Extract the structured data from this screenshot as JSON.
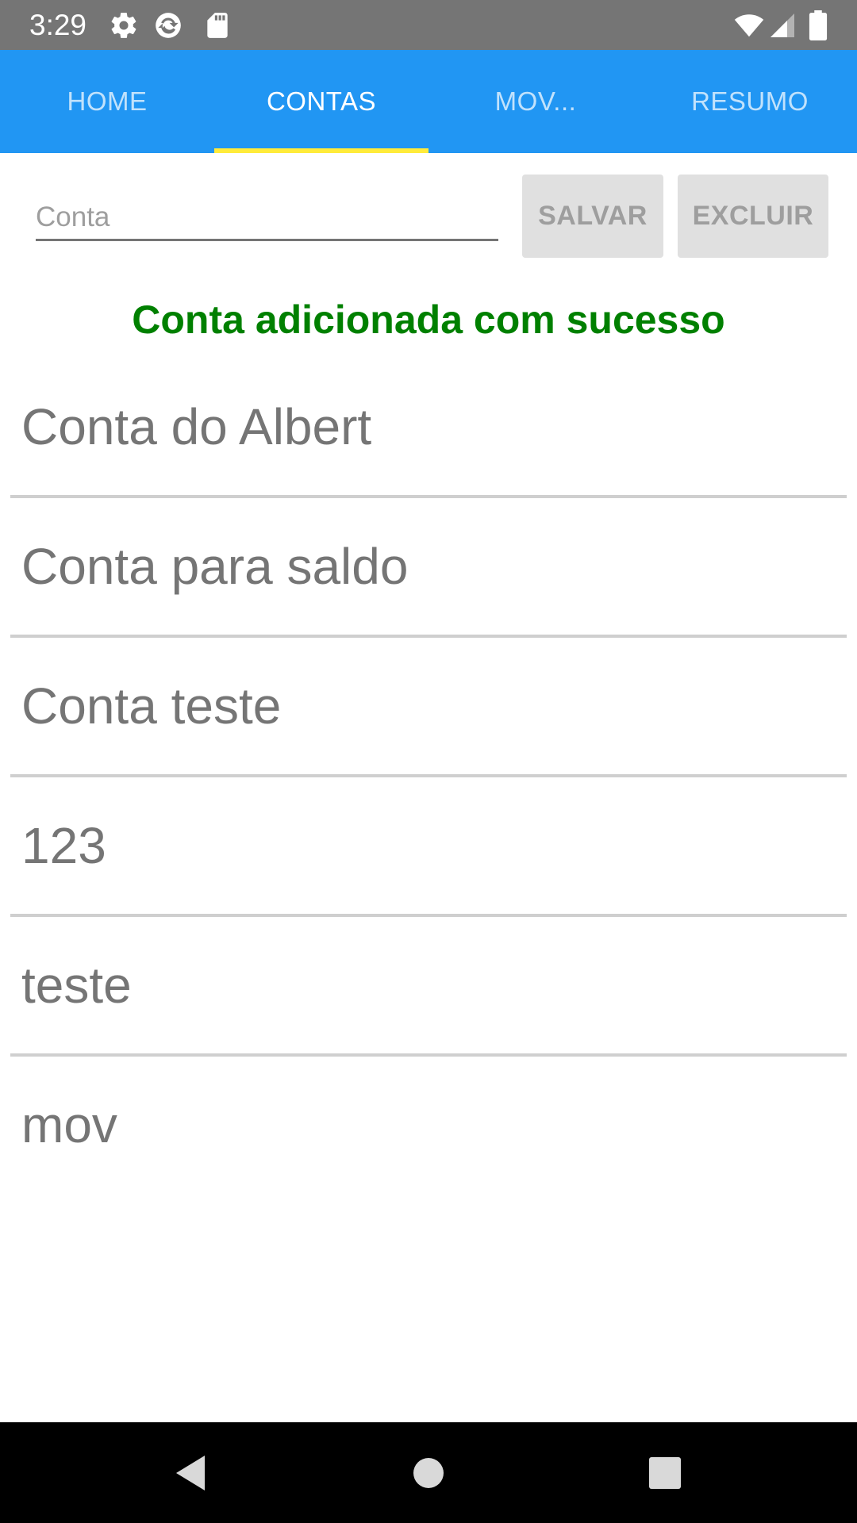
{
  "status_bar": {
    "time": "3:29",
    "icons": [
      "settings-icon",
      "sync-icon",
      "sd-card-icon",
      "wifi-icon",
      "cell-signal-icon",
      "battery-icon"
    ]
  },
  "tabs": [
    {
      "label": "HOME"
    },
    {
      "label": "CONTAS"
    },
    {
      "label": "MOV..."
    },
    {
      "label": "RESUMO"
    }
  ],
  "active_tab": "CONTAS",
  "form": {
    "account_placeholder": "Conta",
    "account_value": "",
    "save_label": "SALVAR",
    "delete_label": "EXCLUIR"
  },
  "message": "Conta adicionada com sucesso",
  "accounts": [
    "Conta do Albert",
    "Conta para saldo",
    "Conta teste",
    "123",
    "teste",
    "mov"
  ],
  "colors": {
    "tab_bar": "#2196f3",
    "tab_indicator": "#ffeb3b",
    "status_bar": "#757575",
    "message": "#008000",
    "button_bg": "#e0e0e0",
    "button_text": "#9e9e9e"
  },
  "nav_bar": {
    "icons": [
      "back-icon",
      "home-icon",
      "recents-icon"
    ]
  }
}
